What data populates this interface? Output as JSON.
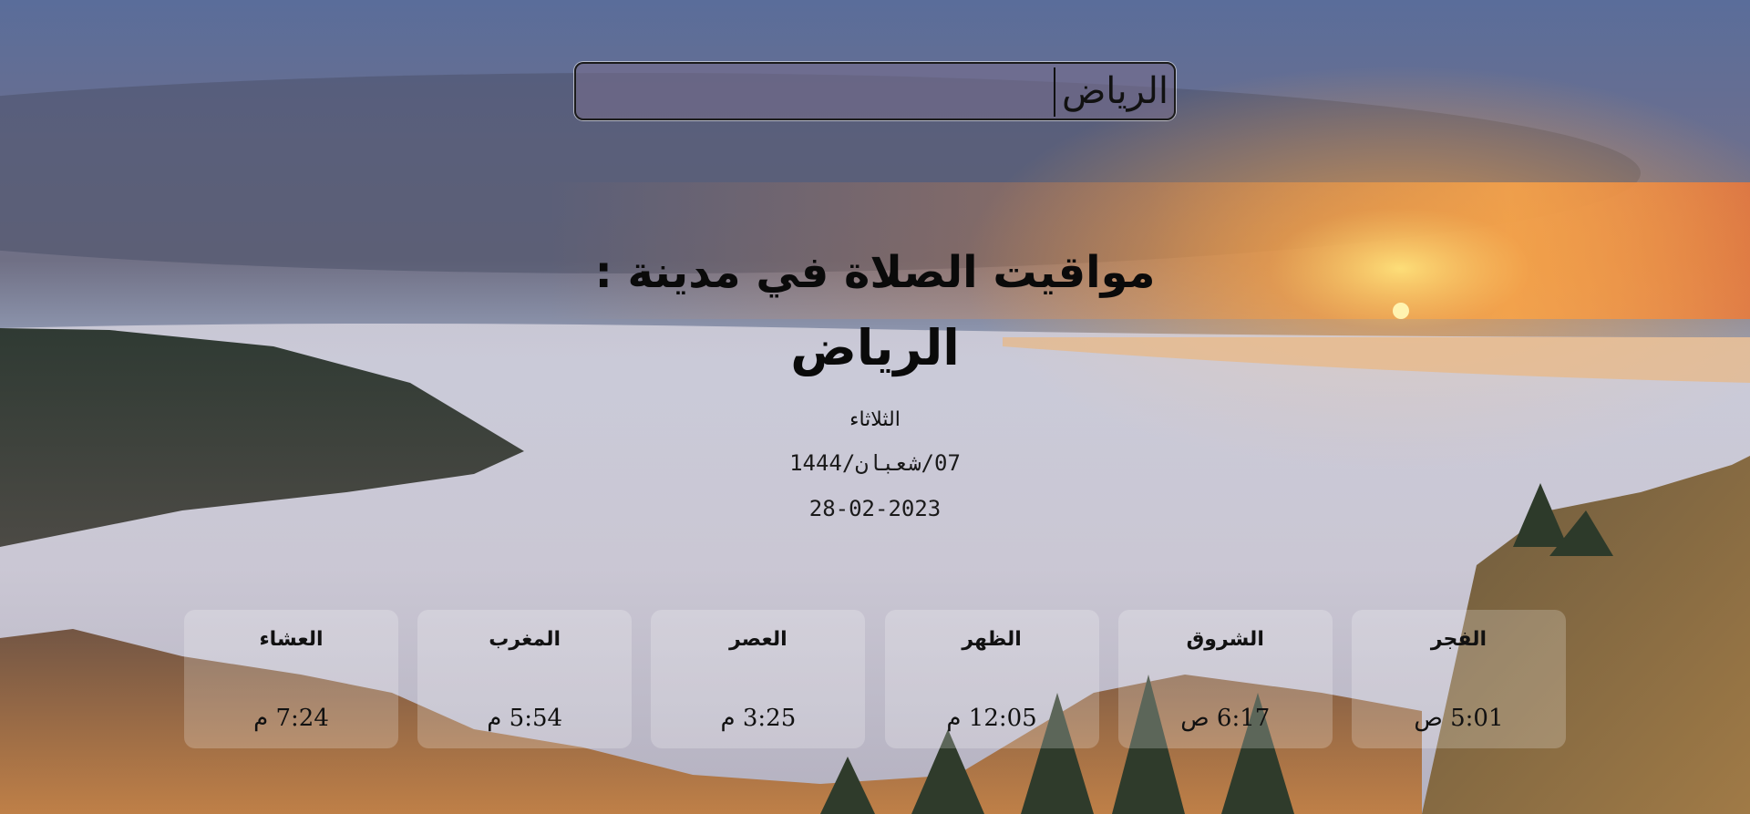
{
  "search": {
    "value": "الرياض",
    "placeholder": ""
  },
  "header": {
    "title": "مواقيت الصلاة في مدينة :",
    "city": "الرياض",
    "day": "الثلاثاء",
    "hijri_date": "07/شعبان/1444",
    "gregorian_date": "28-02-2023"
  },
  "prayers": [
    {
      "name": "الفجر",
      "time": "5:01",
      "period": "ص"
    },
    {
      "name": "الشروق",
      "time": "6:17",
      "period": "ص"
    },
    {
      "name": "الظهر",
      "time": "12:05",
      "period": "م"
    },
    {
      "name": "العصر",
      "time": "3:25",
      "period": "م"
    },
    {
      "name": "المغرب",
      "time": "5:54",
      "period": "م"
    },
    {
      "name": "العشاء",
      "time": "7:24",
      "period": "م"
    }
  ],
  "colors": {
    "text": "#0a0a0a",
    "card_bg": "rgba(255,255,255,0.22)",
    "sun": "#ffe27a",
    "sky_orange": "#f08a3c"
  }
}
